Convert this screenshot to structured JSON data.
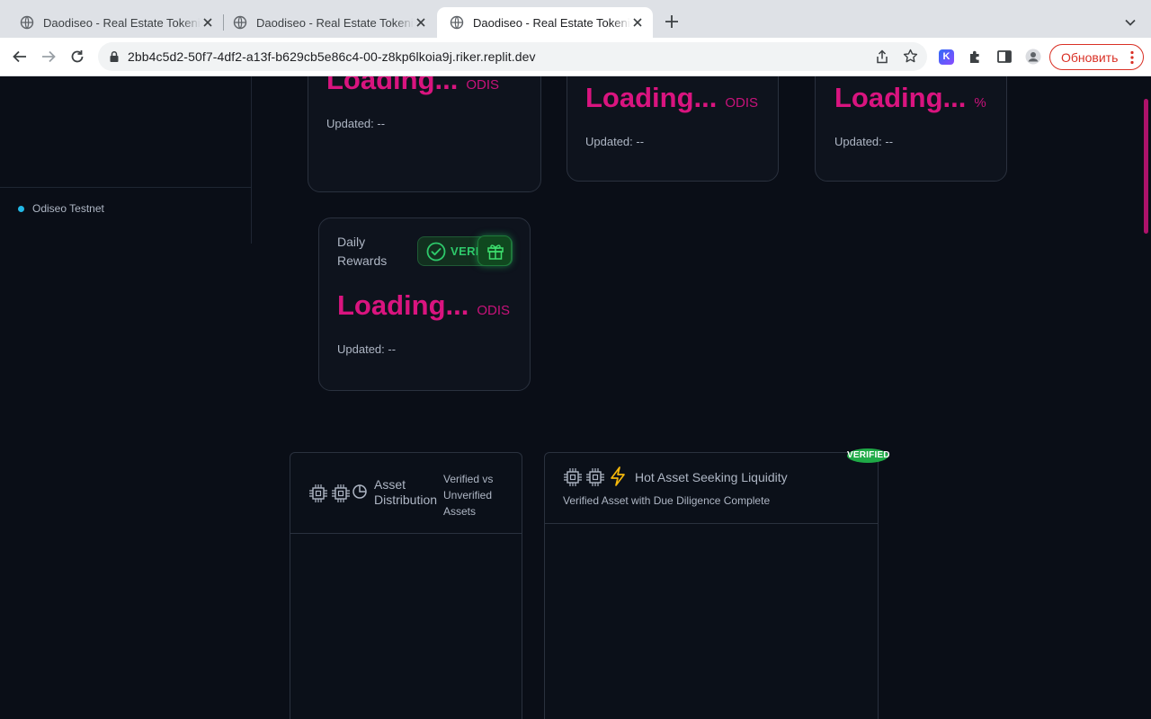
{
  "browser": {
    "tabs": [
      {
        "title": "Daodiseo - Real Estate Tokenization"
      },
      {
        "title": "Daodiseo - Real Estate Tokenization"
      },
      {
        "title": "Daodiseo - Real Estate Tokenization"
      }
    ],
    "url": "2bb4c5d2-50f7-4df2-a13f-b629cb5e86c4-00-z8kp6lkoia9j.riker.replit.dev",
    "extension_label": "K",
    "update_label": "Обновить"
  },
  "sidebar": {
    "network_label": "Odiseo Testnet",
    "network_color": "#22b8e6"
  },
  "stats": {
    "card1": {
      "value": "Loading...",
      "unit": "ODIS",
      "updated": "Updated: --"
    },
    "card2": {
      "value": "Loading...",
      "unit": "ODIS",
      "updated": "Updated: --"
    },
    "card3": {
      "value": "Loading...",
      "unit": "%",
      "updated": "Updated: --"
    },
    "rewards": {
      "title_line1": "Daily",
      "title_line2": "Rewards",
      "badge": "VERIFIED",
      "value": "Loading...",
      "unit": "ODIS",
      "updated": "Updated: --"
    }
  },
  "panels": {
    "distribution": {
      "title_line1": "Asset",
      "title_line2": "Distribution",
      "sub_line1": "Verified vs",
      "sub_line2": "Unverified",
      "sub_line3": "Assets"
    },
    "hot_asset": {
      "title": "Hot Asset Seeking Liquidity",
      "subtitle": "Verified Asset with Due Diligence Complete",
      "floating_badge": "VERIFIED"
    }
  },
  "colors": {
    "accent": "#d9147f",
    "verified_green": "#2ec96b",
    "background": "#0a0e17",
    "bolt": "#f5b80b"
  }
}
